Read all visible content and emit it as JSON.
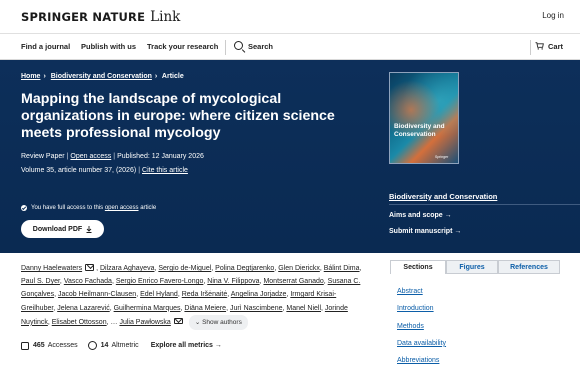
{
  "header": {
    "logo_brand": "SPRINGER NATURE",
    "logo_product": "Link",
    "login": "Log in"
  },
  "nav": {
    "find_journal": "Find a journal",
    "publish": "Publish with us",
    "track": "Track your research",
    "search": "Search",
    "cart": "Cart"
  },
  "breadcrumb": {
    "home": "Home",
    "journal": "Biodiversity and Conservation",
    "current": "Article"
  },
  "article": {
    "title": "Mapping the landscape of mycological organizations in europe: where citizen science meets professional mycology",
    "type": "Review Paper",
    "access": "Open access",
    "published": "Published: 12 January 2026",
    "volume": "Volume 35, article number 37, (2026)",
    "cite": "Cite this article",
    "access_note_prefix": "You have full access to this",
    "access_note_link": "open access",
    "access_note_suffix": "article",
    "download": "Download PDF"
  },
  "journal_panel": {
    "cover_title": "Biodiversity and Conservation",
    "cover_publisher": "Springer",
    "name": "Biodiversity and Conservation",
    "aims": "Aims and scope →",
    "submit": "Submit manuscript →"
  },
  "authors": {
    "list": [
      "Danny Haelewaters",
      "Dilzara Aghayeva",
      "Sergio de-Miguel",
      "Polina Degtjarenko",
      "Glen Dierickx",
      "Bálint Dima",
      "Paul S. Dyer",
      "Vasco Fachada",
      "Sergio Enrico Favero-Longo",
      "Nina V. Filippova",
      "Montserrat Ganado",
      "Susana C. Gonçalves",
      "Jacob Heilmann-Clausen",
      "Edel Hyland",
      "Reda Iršėnaitė",
      "Angelina Jorjadze",
      "Irmgard Krisai-Greilhuber",
      "Jelena Lazarević",
      "Guilhermina Marques",
      "Diāna Meiere",
      "Jurì Nascimbene",
      "Manel Niell",
      "Jorinde Nuytinck",
      "Elisabet Ottosson",
      "Julia Pawłowska"
    ],
    "ellipsis": "…",
    "show_authors": "Show authors"
  },
  "stats": {
    "accesses_count": "465",
    "accesses_label": "Accesses",
    "altmetric_count": "14",
    "altmetric_label": "Altmetric",
    "explore": "Explore all metrics →"
  },
  "sidebar_tabs": {
    "sections": "Sections",
    "figures": "Figures",
    "references": "References"
  },
  "toc": [
    "Abstract",
    "Introduction",
    "Methods",
    "Data availability",
    "Abbreviations"
  ],
  "colors": {
    "hero_bg": "#0a2c56",
    "link_blue": "#0c5ea8"
  }
}
